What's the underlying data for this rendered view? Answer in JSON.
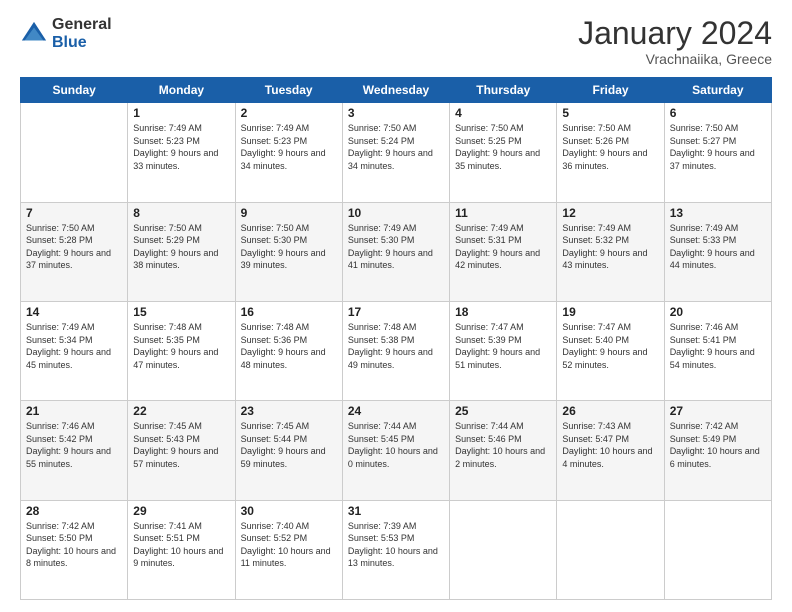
{
  "header": {
    "logo_general": "General",
    "logo_blue": "Blue",
    "month_year": "January 2024",
    "location": "Vrachnaiika, Greece"
  },
  "columns": [
    "Sunday",
    "Monday",
    "Tuesday",
    "Wednesday",
    "Thursday",
    "Friday",
    "Saturday"
  ],
  "weeks": [
    [
      {
        "day": "",
        "sunrise": "",
        "sunset": "",
        "daylight": ""
      },
      {
        "day": "1",
        "sunrise": "Sunrise: 7:49 AM",
        "sunset": "Sunset: 5:23 PM",
        "daylight": "Daylight: 9 hours and 33 minutes."
      },
      {
        "day": "2",
        "sunrise": "Sunrise: 7:49 AM",
        "sunset": "Sunset: 5:23 PM",
        "daylight": "Daylight: 9 hours and 34 minutes."
      },
      {
        "day": "3",
        "sunrise": "Sunrise: 7:50 AM",
        "sunset": "Sunset: 5:24 PM",
        "daylight": "Daylight: 9 hours and 34 minutes."
      },
      {
        "day": "4",
        "sunrise": "Sunrise: 7:50 AM",
        "sunset": "Sunset: 5:25 PM",
        "daylight": "Daylight: 9 hours and 35 minutes."
      },
      {
        "day": "5",
        "sunrise": "Sunrise: 7:50 AM",
        "sunset": "Sunset: 5:26 PM",
        "daylight": "Daylight: 9 hours and 36 minutes."
      },
      {
        "day": "6",
        "sunrise": "Sunrise: 7:50 AM",
        "sunset": "Sunset: 5:27 PM",
        "daylight": "Daylight: 9 hours and 37 minutes."
      }
    ],
    [
      {
        "day": "7",
        "sunrise": "Sunrise: 7:50 AM",
        "sunset": "Sunset: 5:28 PM",
        "daylight": "Daylight: 9 hours and 37 minutes."
      },
      {
        "day": "8",
        "sunrise": "Sunrise: 7:50 AM",
        "sunset": "Sunset: 5:29 PM",
        "daylight": "Daylight: 9 hours and 38 minutes."
      },
      {
        "day": "9",
        "sunrise": "Sunrise: 7:50 AM",
        "sunset": "Sunset: 5:30 PM",
        "daylight": "Daylight: 9 hours and 39 minutes."
      },
      {
        "day": "10",
        "sunrise": "Sunrise: 7:49 AM",
        "sunset": "Sunset: 5:30 PM",
        "daylight": "Daylight: 9 hours and 41 minutes."
      },
      {
        "day": "11",
        "sunrise": "Sunrise: 7:49 AM",
        "sunset": "Sunset: 5:31 PM",
        "daylight": "Daylight: 9 hours and 42 minutes."
      },
      {
        "day": "12",
        "sunrise": "Sunrise: 7:49 AM",
        "sunset": "Sunset: 5:32 PM",
        "daylight": "Daylight: 9 hours and 43 minutes."
      },
      {
        "day": "13",
        "sunrise": "Sunrise: 7:49 AM",
        "sunset": "Sunset: 5:33 PM",
        "daylight": "Daylight: 9 hours and 44 minutes."
      }
    ],
    [
      {
        "day": "14",
        "sunrise": "Sunrise: 7:49 AM",
        "sunset": "Sunset: 5:34 PM",
        "daylight": "Daylight: 9 hours and 45 minutes."
      },
      {
        "day": "15",
        "sunrise": "Sunrise: 7:48 AM",
        "sunset": "Sunset: 5:35 PM",
        "daylight": "Daylight: 9 hours and 47 minutes."
      },
      {
        "day": "16",
        "sunrise": "Sunrise: 7:48 AM",
        "sunset": "Sunset: 5:36 PM",
        "daylight": "Daylight: 9 hours and 48 minutes."
      },
      {
        "day": "17",
        "sunrise": "Sunrise: 7:48 AM",
        "sunset": "Sunset: 5:38 PM",
        "daylight": "Daylight: 9 hours and 49 minutes."
      },
      {
        "day": "18",
        "sunrise": "Sunrise: 7:47 AM",
        "sunset": "Sunset: 5:39 PM",
        "daylight": "Daylight: 9 hours and 51 minutes."
      },
      {
        "day": "19",
        "sunrise": "Sunrise: 7:47 AM",
        "sunset": "Sunset: 5:40 PM",
        "daylight": "Daylight: 9 hours and 52 minutes."
      },
      {
        "day": "20",
        "sunrise": "Sunrise: 7:46 AM",
        "sunset": "Sunset: 5:41 PM",
        "daylight": "Daylight: 9 hours and 54 minutes."
      }
    ],
    [
      {
        "day": "21",
        "sunrise": "Sunrise: 7:46 AM",
        "sunset": "Sunset: 5:42 PM",
        "daylight": "Daylight: 9 hours and 55 minutes."
      },
      {
        "day": "22",
        "sunrise": "Sunrise: 7:45 AM",
        "sunset": "Sunset: 5:43 PM",
        "daylight": "Daylight: 9 hours and 57 minutes."
      },
      {
        "day": "23",
        "sunrise": "Sunrise: 7:45 AM",
        "sunset": "Sunset: 5:44 PM",
        "daylight": "Daylight: 9 hours and 59 minutes."
      },
      {
        "day": "24",
        "sunrise": "Sunrise: 7:44 AM",
        "sunset": "Sunset: 5:45 PM",
        "daylight": "Daylight: 10 hours and 0 minutes."
      },
      {
        "day": "25",
        "sunrise": "Sunrise: 7:44 AM",
        "sunset": "Sunset: 5:46 PM",
        "daylight": "Daylight: 10 hours and 2 minutes."
      },
      {
        "day": "26",
        "sunrise": "Sunrise: 7:43 AM",
        "sunset": "Sunset: 5:47 PM",
        "daylight": "Daylight: 10 hours and 4 minutes."
      },
      {
        "day": "27",
        "sunrise": "Sunrise: 7:42 AM",
        "sunset": "Sunset: 5:49 PM",
        "daylight": "Daylight: 10 hours and 6 minutes."
      }
    ],
    [
      {
        "day": "28",
        "sunrise": "Sunrise: 7:42 AM",
        "sunset": "Sunset: 5:50 PM",
        "daylight": "Daylight: 10 hours and 8 minutes."
      },
      {
        "day": "29",
        "sunrise": "Sunrise: 7:41 AM",
        "sunset": "Sunset: 5:51 PM",
        "daylight": "Daylight: 10 hours and 9 minutes."
      },
      {
        "day": "30",
        "sunrise": "Sunrise: 7:40 AM",
        "sunset": "Sunset: 5:52 PM",
        "daylight": "Daylight: 10 hours and 11 minutes."
      },
      {
        "day": "31",
        "sunrise": "Sunrise: 7:39 AM",
        "sunset": "Sunset: 5:53 PM",
        "daylight": "Daylight: 10 hours and 13 minutes."
      },
      {
        "day": "",
        "sunrise": "",
        "sunset": "",
        "daylight": ""
      },
      {
        "day": "",
        "sunrise": "",
        "sunset": "",
        "daylight": ""
      },
      {
        "day": "",
        "sunrise": "",
        "sunset": "",
        "daylight": ""
      }
    ]
  ]
}
